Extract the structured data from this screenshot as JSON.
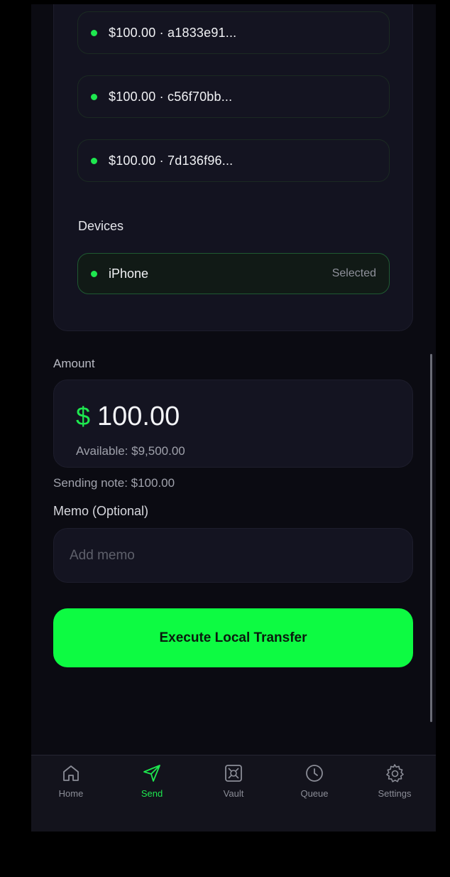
{
  "notes": [
    {
      "label": "$100.00 · a1833e91..."
    },
    {
      "label": "$100.00 · c56f70bb..."
    },
    {
      "label": "$100.00 · 7d136f96..."
    }
  ],
  "devices": {
    "heading": "Devices",
    "items": [
      {
        "name": "iPhone",
        "status": "Selected"
      }
    ]
  },
  "amount": {
    "label": "Amount",
    "currency_symbol": "$",
    "value": "100.00",
    "available": "Available: $9,500.00"
  },
  "sending_note": "Sending note: $100.00",
  "memo": {
    "label": "Memo (Optional)",
    "placeholder": "Add memo",
    "value": ""
  },
  "execute_button": {
    "label": "Execute Local Transfer"
  },
  "tabs": [
    {
      "label": "Home",
      "icon": "home-icon",
      "active": false
    },
    {
      "label": "Send",
      "icon": "send-icon",
      "active": true
    },
    {
      "label": "Vault",
      "icon": "vault-icon",
      "active": false
    },
    {
      "label": "Queue",
      "icon": "clock-icon",
      "active": false
    },
    {
      "label": "Settings",
      "icon": "gear-icon",
      "active": false
    }
  ],
  "colors": {
    "accent": "#1ee84f",
    "button": "#0dfb42",
    "background": "#0b0b12",
    "card": "#141421"
  }
}
